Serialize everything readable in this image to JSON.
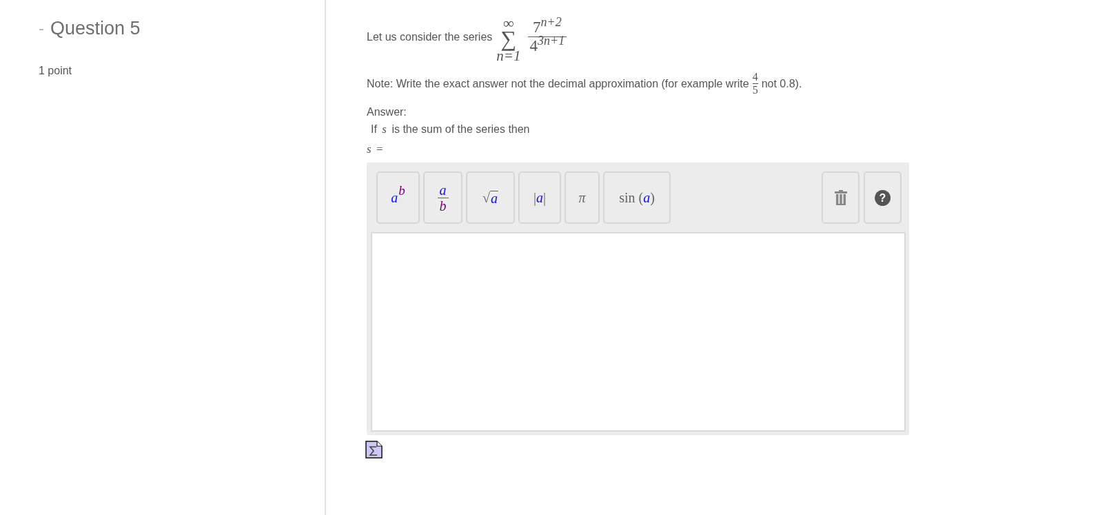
{
  "question": {
    "toggle": "-",
    "title": "Question 5",
    "points": "1 point"
  },
  "prompt": {
    "text": "Let us consider the series",
    "series": {
      "upper": "∞",
      "operator": "∑",
      "lower": "n=1",
      "numerator": "7$^{n+2}$",
      "denominator": "4$^{3n+1}$"
    }
  },
  "note": {
    "before": "Note: Write the exact answer not the decimal approximation (for example write",
    "numerator": "4",
    "denominator": "5",
    "after": "not 0.8)."
  },
  "answer": {
    "label": "Answer:",
    "sentence": "If *s* is the sum of the series then",
    "lead": "*s* ="
  },
  "editor": {
    "tools": [
      {
        "kind": "power",
        "base": "a",
        "exponent": "b"
      },
      {
        "kind": "fraction",
        "numerator": "a",
        "denominator": "b"
      },
      {
        "kind": "root",
        "symbol": "√",
        "radicand": "a"
      },
      {
        "kind": "abs",
        "open": "|",
        "argument": "a",
        "close": "|"
      },
      {
        "kind": "symbol",
        "label": "π"
      },
      {
        "kind": "function",
        "name": "sin",
        "open": "(",
        "argument": "a",
        "close": ")"
      }
    ],
    "actions": [
      {
        "kind": "clear"
      },
      {
        "kind": "help",
        "glyph": "?"
      }
    ]
  }
}
